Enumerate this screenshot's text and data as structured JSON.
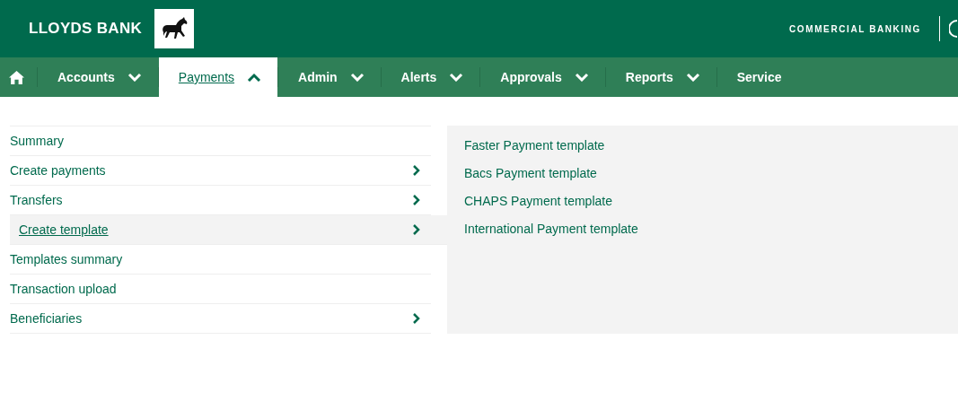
{
  "header": {
    "brand": "LLOYDS BANK",
    "division": "COMMERCIAL BANKING"
  },
  "nav": [
    {
      "label": "Accounts",
      "dropdown": true,
      "selected": false
    },
    {
      "label": "Payments",
      "dropdown": true,
      "selected": true
    },
    {
      "label": "Admin",
      "dropdown": true,
      "selected": false
    },
    {
      "label": "Alerts",
      "dropdown": true,
      "selected": false
    },
    {
      "label": "Approvals",
      "dropdown": true,
      "selected": false
    },
    {
      "label": "Reports",
      "dropdown": true,
      "selected": false
    },
    {
      "label": "Service",
      "dropdown": false,
      "selected": false
    }
  ],
  "menu": [
    {
      "label": "Summary",
      "submenu": false,
      "selected": false
    },
    {
      "label": "Create payments",
      "submenu": true,
      "selected": false
    },
    {
      "label": "Transfers",
      "submenu": true,
      "selected": false
    },
    {
      "label": "Create template",
      "submenu": true,
      "selected": true
    },
    {
      "label": "Templates summary",
      "submenu": false,
      "selected": false
    },
    {
      "label": "Transaction upload",
      "submenu": false,
      "selected": false
    },
    {
      "label": "Beneficiaries",
      "submenu": true,
      "selected": false
    }
  ],
  "submenu": [
    "Faster Payment template",
    "Bacs Payment template",
    "CHAPS Payment template",
    "International Payment template"
  ]
}
